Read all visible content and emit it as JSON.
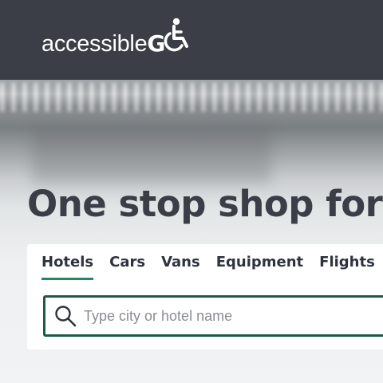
{
  "header": {
    "logo_light": "accessible",
    "logo_bold": "G",
    "logo_icon": "wheelchair-icon"
  },
  "hero": {
    "title": "One stop shop for"
  },
  "search": {
    "tabs": [
      {
        "label": "Hotels",
        "active": true
      },
      {
        "label": "Cars",
        "active": false
      },
      {
        "label": "Vans",
        "active": false
      },
      {
        "label": "Equipment",
        "active": false
      },
      {
        "label": "Flights",
        "active": false
      }
    ],
    "placeholder": "Type city or hotel name",
    "value": "",
    "icon": "search-icon"
  },
  "colors": {
    "header_bg": "#3b3e47",
    "accent_green": "#1f8a5f",
    "input_border": "#1d5b46",
    "title_text": "#3b3e47"
  }
}
